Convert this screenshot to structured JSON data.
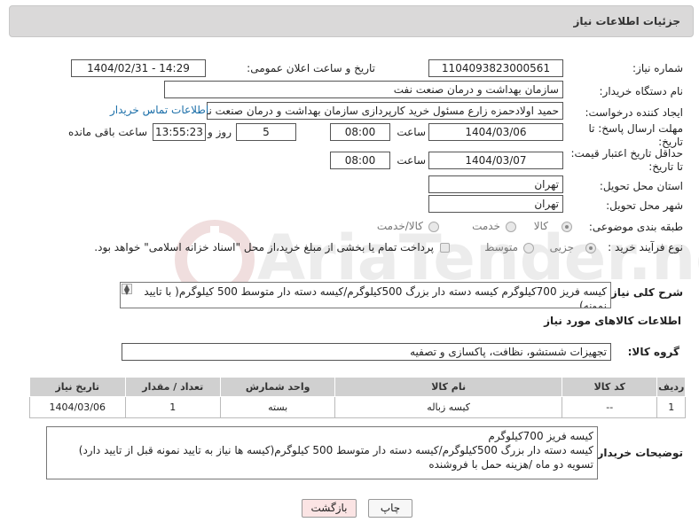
{
  "header": {
    "title": "جزئیات اطلاعات نیاز"
  },
  "fields": {
    "need_number": {
      "label": "شماره نیاز:",
      "value": "1104093823000561"
    },
    "announce": {
      "label": "تاریخ و ساعت اعلان عمومی:",
      "value": "1404/02/31 - 14:29"
    },
    "buyer_org": {
      "label": "نام دستگاه خریدار:",
      "value": "سازمان بهداشت و درمان صنعت نفت"
    },
    "requester": {
      "label": "ایجاد کننده درخواست:",
      "value": "حمید اولادحمزه زارع مسئول خرید کارپردازی سازمان بهداشت و درمان صنعت نفت",
      "contact_link": "اطلاعات تماس خریدار"
    },
    "reply_deadline": {
      "label_line1": "مهلت ارسال پاسخ: تا",
      "label_line2": "تاریخ:",
      "date": "1404/03/06",
      "time_label": "ساعت",
      "time": "08:00",
      "days": "5",
      "days_label": "روز و",
      "remaining": "13:55:23",
      "remaining_label": "ساعت باقی مانده"
    },
    "price_validity": {
      "label_line1": "حداقل تاریخ اعتبار قیمت:",
      "label_line2": "تا تاریخ:",
      "date": "1404/03/07",
      "time_label": "ساعت",
      "time": "08:00"
    },
    "province": {
      "label": "استان محل تحویل:",
      "value": "تهران"
    },
    "city": {
      "label": "شهر محل تحویل:",
      "value": "تهران"
    },
    "category": {
      "label": "طبقه بندی موضوعی:",
      "options": [
        "کالا",
        "خدمت",
        "کالا/خدمت"
      ],
      "selected": "کالا"
    },
    "purchase_type": {
      "label": "نوع فرآیند خرید :",
      "options": [
        "جزیی",
        "متوسط"
      ],
      "selected": "جزیی",
      "payment_note": "پرداخت تمام یا بخشی از مبلغ خرید،از محل \"اسناد خزانه اسلامی\" خواهد بود."
    }
  },
  "description": {
    "label": "شرح کلی نیاز:",
    "value": "کیسه فریز 700کیلوگرم کیسه دسته دار بزرگ 500کیلوگرم/کیسه دسته دار متوسط 500 کیلوگرم( با تایید نمونه)"
  },
  "goods_info": {
    "title": "اطلاعات کالاهای مورد نیاز",
    "group_label": "گروه کالا:",
    "group_value": "تجهیزات شستشو، نظافت، پاکسازی و تصفیه"
  },
  "table": {
    "headers": [
      "ردیف",
      "کد کالا",
      "نام کالا",
      "واحد شمارش",
      "تعداد / مقدار",
      "تاریخ نیاز"
    ],
    "rows": [
      [
        "1",
        "--",
        "کیسه زباله",
        "بسته",
        "1",
        "1404/03/06"
      ]
    ]
  },
  "buyer_notes": {
    "label": "توضیحات خریدار:",
    "lines": [
      "کیسه فریز 700کیلوگرم",
      "کیسه دسته دار بزرگ 500کیلوگرم/کیسه دسته دار متوسط 500 کیلوگرم(کیسه ها نیاز به تایید نمونه قبل از تایید دارد)",
      "تسویه دو ماه /هزینه حمل با فروشنده"
    ]
  },
  "buttons": {
    "print": "چاپ",
    "back": "بازگشت"
  },
  "watermark": {
    "text": "AriaTender.neT"
  },
  "colors": {
    "header_bg": "#dad9d9",
    "link": "#1a6ea8",
    "back_btn": "#fbe4e4",
    "table_header": "#d0d0d0"
  }
}
